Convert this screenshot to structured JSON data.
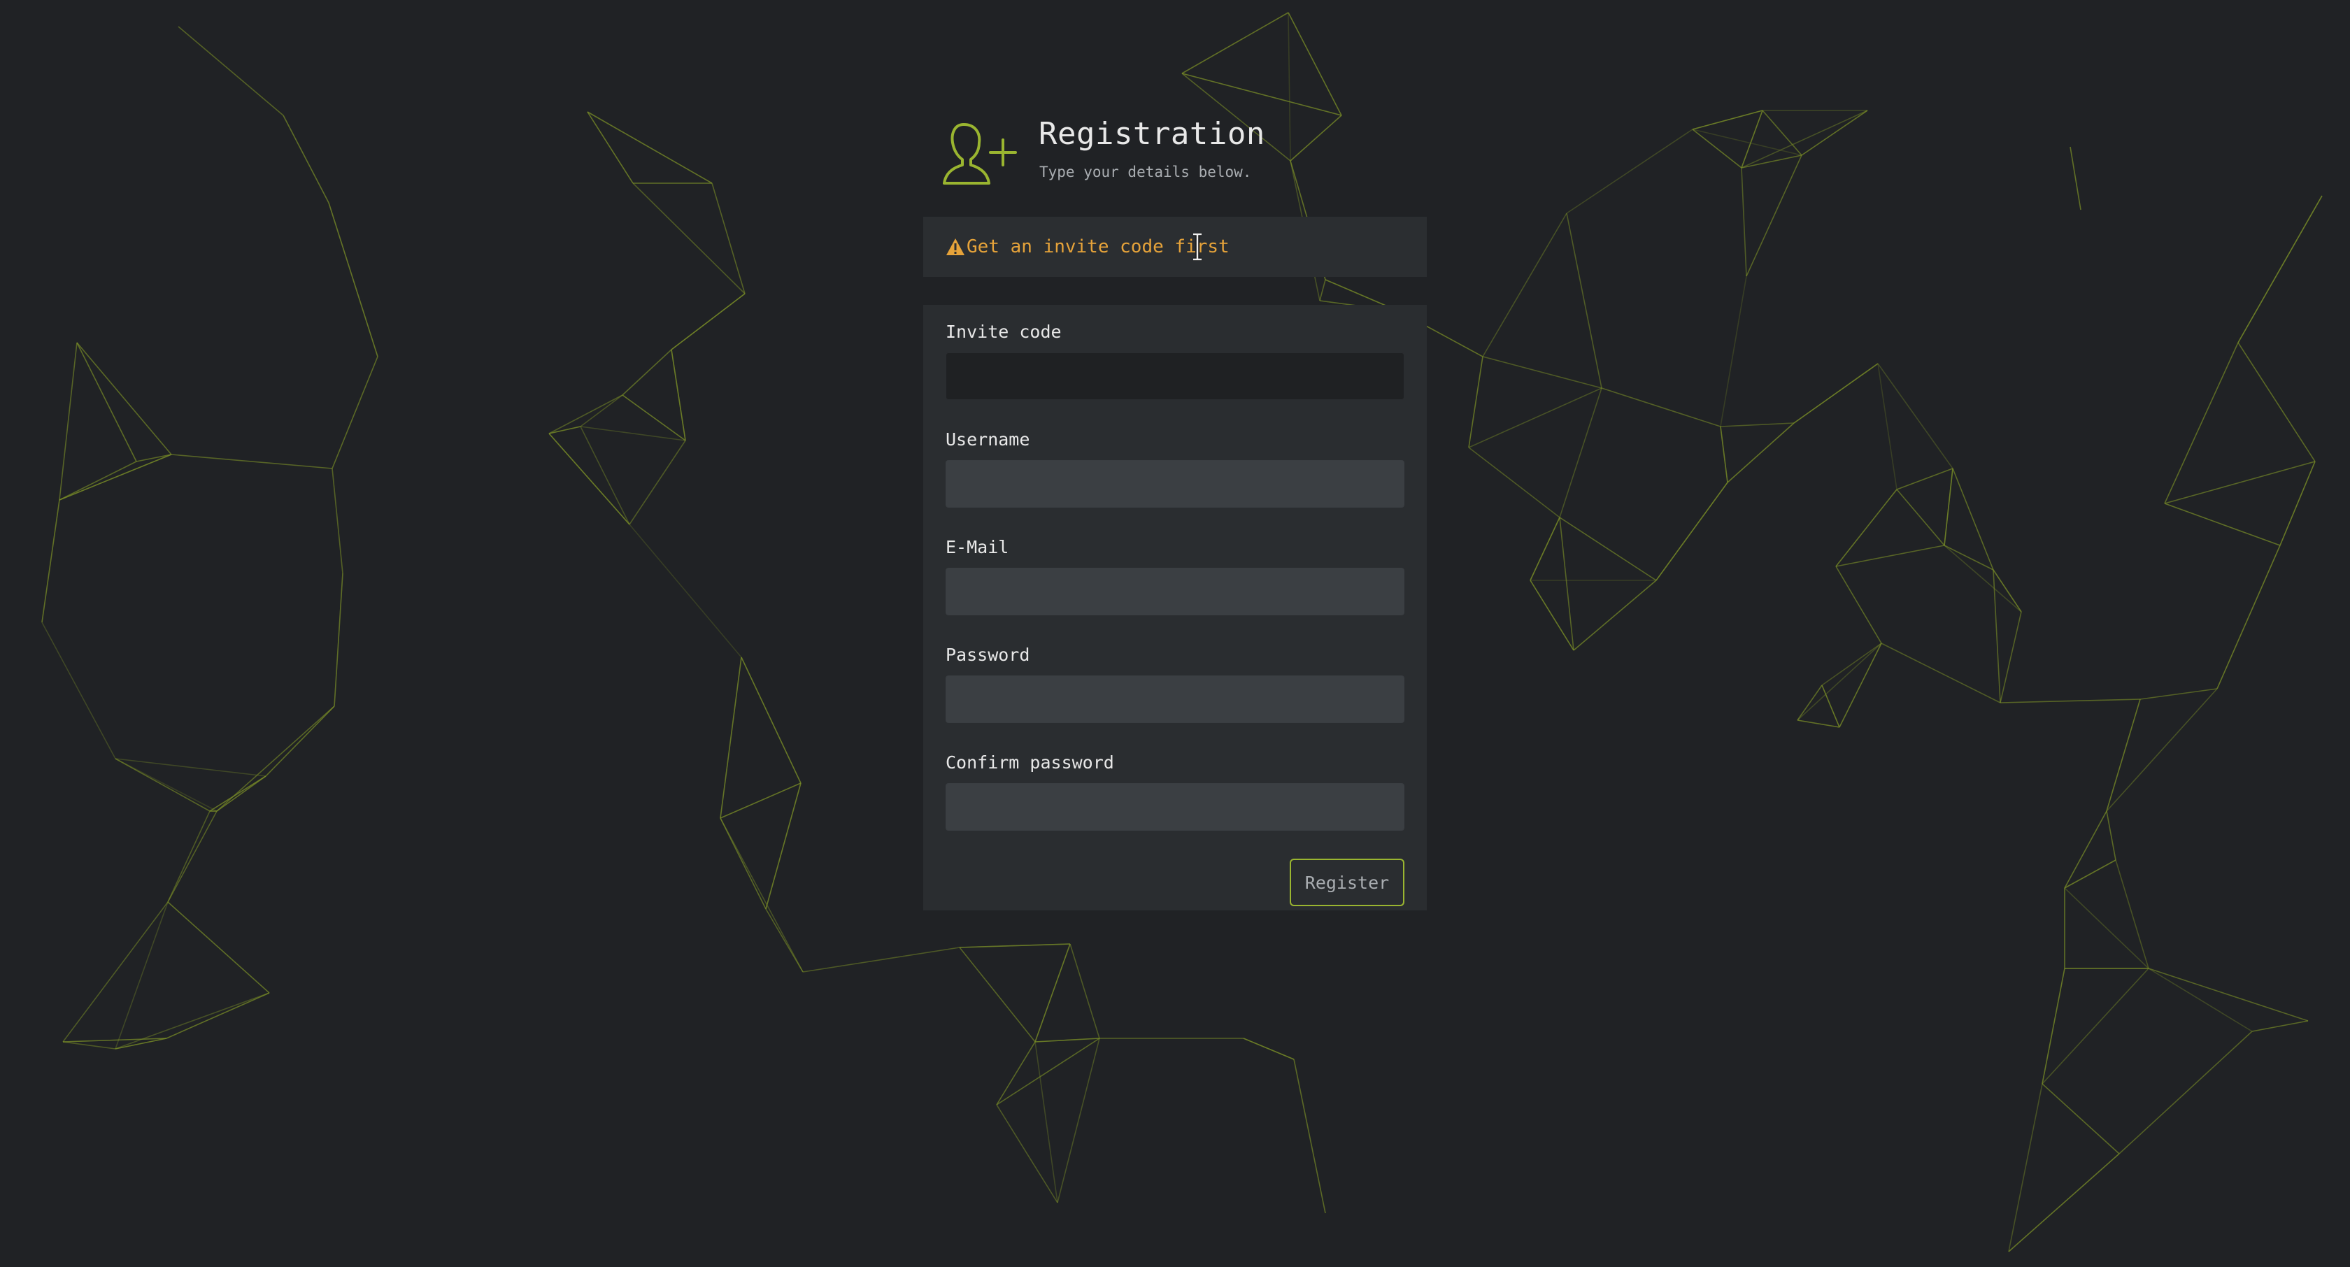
{
  "theme": {
    "accent": "#9ab530",
    "warning": "#e6a33a",
    "background": "#202225",
    "panel": "#2a2d30"
  },
  "header": {
    "icon": "add-user-icon",
    "title": "Registration",
    "subtitle": "Type your details below."
  },
  "alert": {
    "icon": "warning-icon",
    "text": "Get an invite code first"
  },
  "form": {
    "invite_code": {
      "label": "Invite code",
      "value": ""
    },
    "username": {
      "label": "Username",
      "value": ""
    },
    "email": {
      "label": "E-Mail",
      "value": ""
    },
    "password": {
      "label": "Password",
      "value": ""
    },
    "confirm_password": {
      "label": "Confirm password",
      "value": ""
    },
    "submit_label": "Register"
  }
}
